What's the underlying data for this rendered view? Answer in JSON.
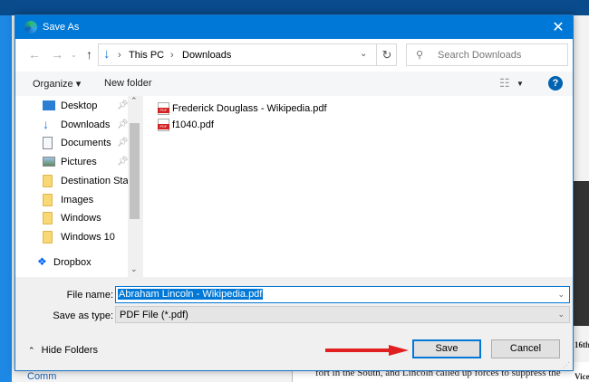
{
  "background": {
    "left_link": "Comm",
    "doc_text": "fort in the South, and Lincoln called up forces to suppress the",
    "side_text_1": "16th",
    "side_text_2": "Vice"
  },
  "dialog": {
    "title": "Save As",
    "close_icon": "close-icon",
    "address": {
      "segments": [
        "This PC",
        "Downloads"
      ],
      "separator": "›"
    },
    "search_placeholder": "Search Downloads",
    "toolbar": {
      "organize": "Organize ▾",
      "new_folder": "New folder",
      "help": "?"
    },
    "nav_items": [
      {
        "label": "Desktop",
        "icon": "desktop-icon",
        "pinned": true
      },
      {
        "label": "Downloads",
        "icon": "download-icon",
        "pinned": true
      },
      {
        "label": "Documents",
        "icon": "documents-icon",
        "pinned": true
      },
      {
        "label": "Pictures",
        "icon": "pictures-icon",
        "pinned": true
      },
      {
        "label": "Destination Stati",
        "icon": "folder-icon",
        "pinned": false
      },
      {
        "label": "Images",
        "icon": "folder-icon",
        "pinned": false
      },
      {
        "label": "Windows",
        "icon": "folder-icon",
        "pinned": false
      },
      {
        "label": "Windows 10",
        "icon": "folder-icon",
        "pinned": false
      },
      {
        "label": "Dropbox",
        "icon": "dropbox-icon",
        "pinned": false
      }
    ],
    "files": [
      {
        "name": "Frederick Douglass - Wikipedia.pdf"
      },
      {
        "name": "f1040.pdf"
      }
    ],
    "file_name_label": "File name:",
    "file_name_value": "Abraham Lincoln - Wikipedia.pdf",
    "save_type_label": "Save as type:",
    "save_type_value": "PDF File (*.pdf)",
    "hide_folders": "Hide Folders",
    "save": "Save",
    "cancel": "Cancel",
    "accent": "#0078d7",
    "annotation_arrow_color": "#e02020"
  }
}
